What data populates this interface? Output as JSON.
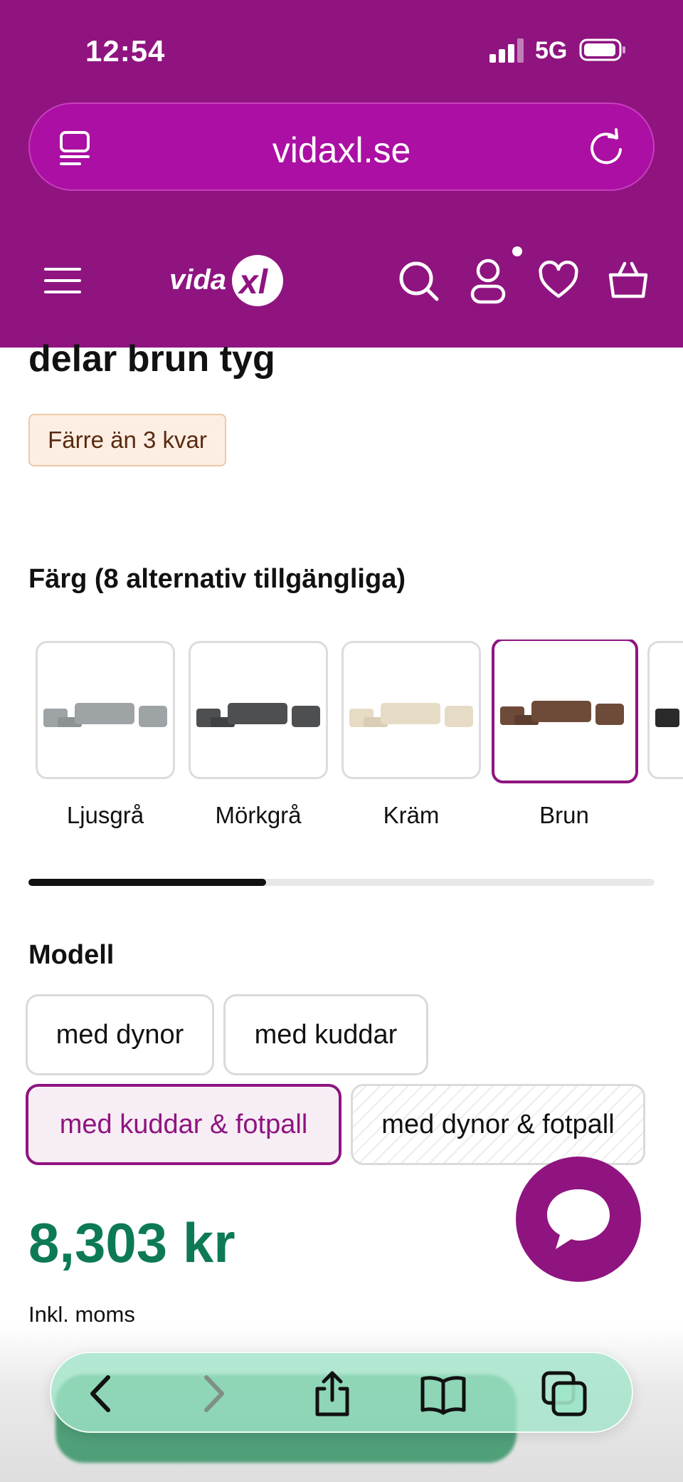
{
  "status_bar": {
    "time": "12:54",
    "network": "5G"
  },
  "browser": {
    "url": "vidaxl.se"
  },
  "site_header": {
    "logo_text": "vidaxl"
  },
  "product": {
    "title_fragment": "delar brun tyg",
    "stock_badge": "Färre än 3 kvar",
    "color_section_label": "Färg (8 alternativ tillgängliga)",
    "colors": [
      {
        "name": "Ljusgrå",
        "swatch": "#9ea3a6"
      },
      {
        "name": "Mörkgrå",
        "swatch": "#4d4f51"
      },
      {
        "name": "Kräm",
        "swatch": "#e6dcc6"
      },
      {
        "name": "Brun",
        "swatch": "#6e4a38",
        "selected": true
      }
    ],
    "color_scroll_progress": 0.38,
    "model_section_label": "Modell",
    "models": [
      {
        "label": "med dynor",
        "state": "default"
      },
      {
        "label": "med kuddar",
        "state": "default"
      },
      {
        "label": "med kuddar & fotpall",
        "state": "selected"
      },
      {
        "label": "med dynor & fotpall",
        "state": "unavailable"
      }
    ],
    "price": "8,303 kr",
    "vat_note": "Inkl. moms"
  },
  "icons": {
    "nav": [
      "hamburger-menu-icon",
      "search-icon",
      "account-icon",
      "wishlist-heart-icon",
      "cart-basket-icon"
    ],
    "toolbar": [
      "back-arrow-icon",
      "forward-arrow-icon",
      "share-icon",
      "bookmarks-icon",
      "tabs-icon"
    ],
    "chat": "chat-bubble-icon"
  },
  "colors": {
    "brand_purple": "#8f1480",
    "price_green": "#0d7a55",
    "badge_bg": "#fdeee3"
  }
}
